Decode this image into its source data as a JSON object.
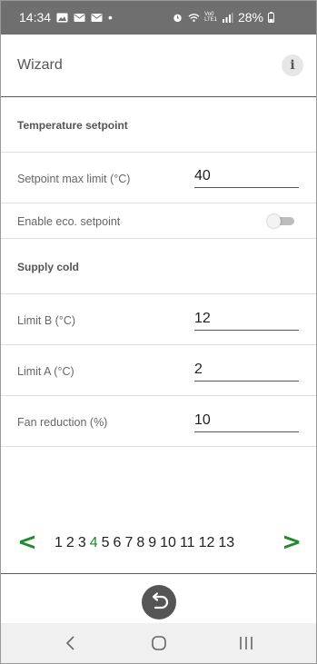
{
  "status_bar": {
    "time": "14:34",
    "dot": "•",
    "network": "Vo0\nLTE1",
    "battery": "28%"
  },
  "header": {
    "title": "Wizard",
    "info_icon_label": "i"
  },
  "sections": [
    {
      "title": "Temperature setpoint"
    },
    {
      "title": "Supply cold"
    }
  ],
  "fields": {
    "setpoint_max_label": "Setpoint max limit  (°C)",
    "setpoint_max_value": "40",
    "eco_label": "Enable eco. setpoint",
    "eco_enabled": false,
    "limit_b_label": "Limit B  (°C)",
    "limit_b_value": "12",
    "limit_a_label": "Limit A  (°C)",
    "limit_a_value": "2",
    "fan_label": "Fan reduction  (%)",
    "fan_value": "10"
  },
  "pager": {
    "prev": "<",
    "next": ">",
    "pages": [
      "1",
      "2",
      "3",
      "4",
      "5",
      "6",
      "7",
      "8",
      "9",
      "10",
      "11",
      "12",
      "13"
    ],
    "current": "4"
  },
  "colors": {
    "accent": "#1f8a2e",
    "statusbar": "#6f6f6f"
  }
}
